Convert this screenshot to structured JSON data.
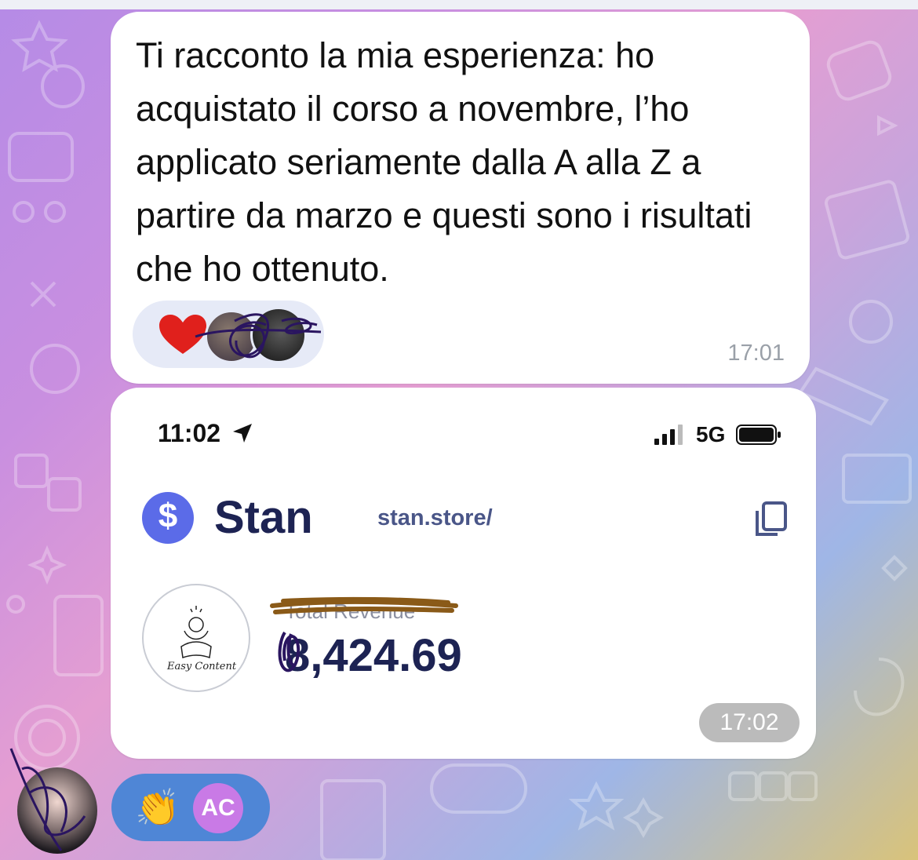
{
  "message_1": {
    "text": "Ti racconto la mia esperienza: ho acquistato il corso a novembre, l’ho applicato seriamente dalla A alla Z a partire da marzo e questi sono i risultati che ho ottenuto.",
    "time": "17:01",
    "reactions": {
      "emoji": "heart-icon"
    }
  },
  "message_2": {
    "time": "17:02",
    "screenshot": {
      "status_time": "11:02",
      "network": "5G",
      "brand": "Stan",
      "logo_symbol": "$",
      "store_url": "stan.store/",
      "store_avatar_caption": "Easy Content",
      "revenue_label": "Total Revenue",
      "revenue_amount": "8,424.69"
    }
  },
  "bottom_reactions": {
    "emoji": "👏",
    "initials": "AC"
  },
  "colors": {
    "bubble": "#ffffff",
    "stan_brand": "#5b6be8",
    "stan_text": "#1d2353",
    "reaction_bg": "#e6eaf7",
    "bottom_reaction_bg": "#4f86d6",
    "ac_badge": "#c97ae6"
  }
}
